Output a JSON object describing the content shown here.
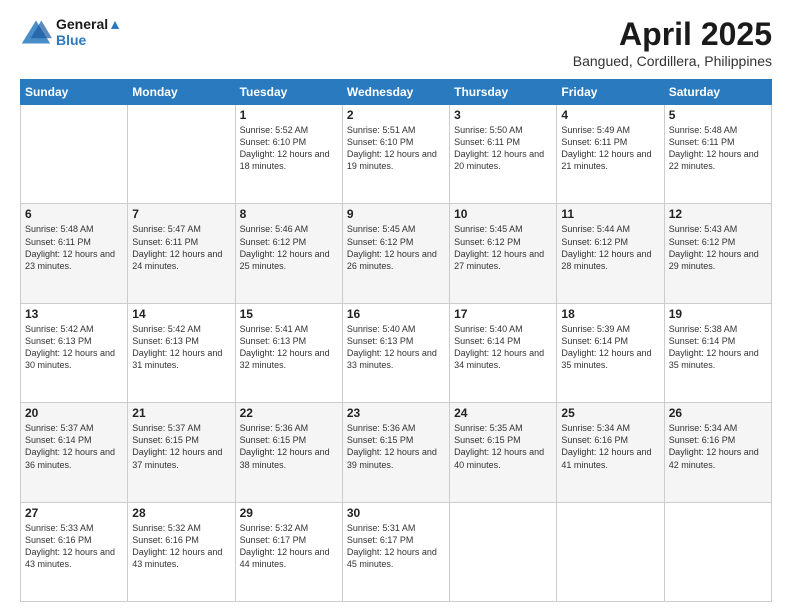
{
  "logo": {
    "line1": "General",
    "line2": "Blue"
  },
  "title": "April 2025",
  "subtitle": "Bangued, Cordillera, Philippines",
  "days_of_week": [
    "Sunday",
    "Monday",
    "Tuesday",
    "Wednesday",
    "Thursday",
    "Friday",
    "Saturday"
  ],
  "weeks": [
    [
      {
        "day": "",
        "sunrise": "",
        "sunset": "",
        "daylight": ""
      },
      {
        "day": "",
        "sunrise": "",
        "sunset": "",
        "daylight": ""
      },
      {
        "day": "1",
        "sunrise": "Sunrise: 5:52 AM",
        "sunset": "Sunset: 6:10 PM",
        "daylight": "Daylight: 12 hours and 18 minutes."
      },
      {
        "day": "2",
        "sunrise": "Sunrise: 5:51 AM",
        "sunset": "Sunset: 6:10 PM",
        "daylight": "Daylight: 12 hours and 19 minutes."
      },
      {
        "day": "3",
        "sunrise": "Sunrise: 5:50 AM",
        "sunset": "Sunset: 6:11 PM",
        "daylight": "Daylight: 12 hours and 20 minutes."
      },
      {
        "day": "4",
        "sunrise": "Sunrise: 5:49 AM",
        "sunset": "Sunset: 6:11 PM",
        "daylight": "Daylight: 12 hours and 21 minutes."
      },
      {
        "day": "5",
        "sunrise": "Sunrise: 5:48 AM",
        "sunset": "Sunset: 6:11 PM",
        "daylight": "Daylight: 12 hours and 22 minutes."
      }
    ],
    [
      {
        "day": "6",
        "sunrise": "Sunrise: 5:48 AM",
        "sunset": "Sunset: 6:11 PM",
        "daylight": "Daylight: 12 hours and 23 minutes."
      },
      {
        "day": "7",
        "sunrise": "Sunrise: 5:47 AM",
        "sunset": "Sunset: 6:11 PM",
        "daylight": "Daylight: 12 hours and 24 minutes."
      },
      {
        "day": "8",
        "sunrise": "Sunrise: 5:46 AM",
        "sunset": "Sunset: 6:12 PM",
        "daylight": "Daylight: 12 hours and 25 minutes."
      },
      {
        "day": "9",
        "sunrise": "Sunrise: 5:45 AM",
        "sunset": "Sunset: 6:12 PM",
        "daylight": "Daylight: 12 hours and 26 minutes."
      },
      {
        "day": "10",
        "sunrise": "Sunrise: 5:45 AM",
        "sunset": "Sunset: 6:12 PM",
        "daylight": "Daylight: 12 hours and 27 minutes."
      },
      {
        "day": "11",
        "sunrise": "Sunrise: 5:44 AM",
        "sunset": "Sunset: 6:12 PM",
        "daylight": "Daylight: 12 hours and 28 minutes."
      },
      {
        "day": "12",
        "sunrise": "Sunrise: 5:43 AM",
        "sunset": "Sunset: 6:12 PM",
        "daylight": "Daylight: 12 hours and 29 minutes."
      }
    ],
    [
      {
        "day": "13",
        "sunrise": "Sunrise: 5:42 AM",
        "sunset": "Sunset: 6:13 PM",
        "daylight": "Daylight: 12 hours and 30 minutes."
      },
      {
        "day": "14",
        "sunrise": "Sunrise: 5:42 AM",
        "sunset": "Sunset: 6:13 PM",
        "daylight": "Daylight: 12 hours and 31 minutes."
      },
      {
        "day": "15",
        "sunrise": "Sunrise: 5:41 AM",
        "sunset": "Sunset: 6:13 PM",
        "daylight": "Daylight: 12 hours and 32 minutes."
      },
      {
        "day": "16",
        "sunrise": "Sunrise: 5:40 AM",
        "sunset": "Sunset: 6:13 PM",
        "daylight": "Daylight: 12 hours and 33 minutes."
      },
      {
        "day": "17",
        "sunrise": "Sunrise: 5:40 AM",
        "sunset": "Sunset: 6:14 PM",
        "daylight": "Daylight: 12 hours and 34 minutes."
      },
      {
        "day": "18",
        "sunrise": "Sunrise: 5:39 AM",
        "sunset": "Sunset: 6:14 PM",
        "daylight": "Daylight: 12 hours and 35 minutes."
      },
      {
        "day": "19",
        "sunrise": "Sunrise: 5:38 AM",
        "sunset": "Sunset: 6:14 PM",
        "daylight": "Daylight: 12 hours and 35 minutes."
      }
    ],
    [
      {
        "day": "20",
        "sunrise": "Sunrise: 5:37 AM",
        "sunset": "Sunset: 6:14 PM",
        "daylight": "Daylight: 12 hours and 36 minutes."
      },
      {
        "day": "21",
        "sunrise": "Sunrise: 5:37 AM",
        "sunset": "Sunset: 6:15 PM",
        "daylight": "Daylight: 12 hours and 37 minutes."
      },
      {
        "day": "22",
        "sunrise": "Sunrise: 5:36 AM",
        "sunset": "Sunset: 6:15 PM",
        "daylight": "Daylight: 12 hours and 38 minutes."
      },
      {
        "day": "23",
        "sunrise": "Sunrise: 5:36 AM",
        "sunset": "Sunset: 6:15 PM",
        "daylight": "Daylight: 12 hours and 39 minutes."
      },
      {
        "day": "24",
        "sunrise": "Sunrise: 5:35 AM",
        "sunset": "Sunset: 6:15 PM",
        "daylight": "Daylight: 12 hours and 40 minutes."
      },
      {
        "day": "25",
        "sunrise": "Sunrise: 5:34 AM",
        "sunset": "Sunset: 6:16 PM",
        "daylight": "Daylight: 12 hours and 41 minutes."
      },
      {
        "day": "26",
        "sunrise": "Sunrise: 5:34 AM",
        "sunset": "Sunset: 6:16 PM",
        "daylight": "Daylight: 12 hours and 42 minutes."
      }
    ],
    [
      {
        "day": "27",
        "sunrise": "Sunrise: 5:33 AM",
        "sunset": "Sunset: 6:16 PM",
        "daylight": "Daylight: 12 hours and 43 minutes."
      },
      {
        "day": "28",
        "sunrise": "Sunrise: 5:32 AM",
        "sunset": "Sunset: 6:16 PM",
        "daylight": "Daylight: 12 hours and 43 minutes."
      },
      {
        "day": "29",
        "sunrise": "Sunrise: 5:32 AM",
        "sunset": "Sunset: 6:17 PM",
        "daylight": "Daylight: 12 hours and 44 minutes."
      },
      {
        "day": "30",
        "sunrise": "Sunrise: 5:31 AM",
        "sunset": "Sunset: 6:17 PM",
        "daylight": "Daylight: 12 hours and 45 minutes."
      },
      {
        "day": "",
        "sunrise": "",
        "sunset": "",
        "daylight": ""
      },
      {
        "day": "",
        "sunrise": "",
        "sunset": "",
        "daylight": ""
      },
      {
        "day": "",
        "sunrise": "",
        "sunset": "",
        "daylight": ""
      }
    ]
  ]
}
